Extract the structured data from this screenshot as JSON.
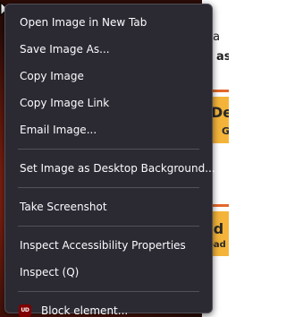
{
  "menu": {
    "items": [
      {
        "label": "Open Image in New Tab"
      },
      {
        "label": "Save Image As..."
      },
      {
        "label": "Copy Image"
      },
      {
        "label": "Copy Image Link"
      },
      {
        "label": "Email Image..."
      },
      {
        "label": "Set Image as Desktop Background..."
      },
      {
        "label": "Take Screenshot"
      },
      {
        "label": "Inspect Accessibility Properties"
      },
      {
        "label": "Inspect (Q)"
      },
      {
        "label": "Block element...",
        "icon": "ublock-extension-icon",
        "icon_text": "UD",
        "icon_color": "#800000"
      }
    ]
  },
  "background_page": {
    "texts": [
      "e a",
      "as",
      "De",
      "G",
      "ad",
      "oad"
    ]
  },
  "colors": {
    "menu_background": "#2b2a33",
    "menu_text": "#fbfbfe",
    "separator": "#52515a",
    "page_accent_gold": "#f4b43a"
  }
}
